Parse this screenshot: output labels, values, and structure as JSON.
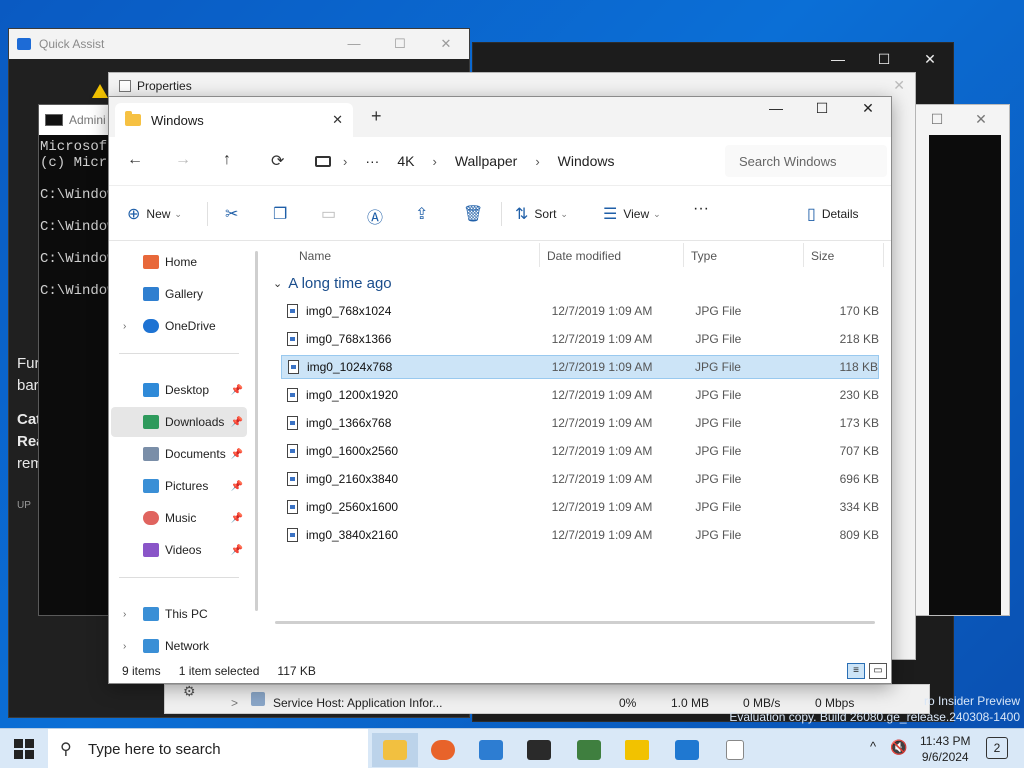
{
  "quick_assist": {
    "title": "Quick Assist",
    "body_lines": [
      "Fur",
      "bar",
      "Cat",
      "Rea",
      "rem",
      "UP"
    ],
    "min": "—",
    "max": "☐",
    "close": "✕"
  },
  "back_window": {
    "min": "—",
    "max": "☐",
    "close": "✕"
  },
  "cmd": {
    "title": "Admini",
    "lines": [
      "Microsoft",
      "(c) Micro",
      "",
      "C:\\Window",
      "",
      "C:\\Window",
      "",
      "C:\\Window",
      "",
      "C:\\Window"
    ]
  },
  "properties": {
    "title": "Properties",
    "close": "✕"
  },
  "task_manager": {
    "process": "Service Host: Application Infor...",
    "cpu": "0%",
    "memory": "1.0 MB",
    "disk": "0 MB/s",
    "network": "0 Mbps",
    "expand": ">"
  },
  "right_window": {
    "max": "☐",
    "close": "✕"
  },
  "explorer": {
    "tab_title": "Windows",
    "tab_close": "✕",
    "new_tab": "+",
    "window_controls": {
      "min": "—",
      "max": "☐",
      "close": "✕"
    },
    "nav": {
      "back": "←",
      "forward": "→",
      "up": "↑",
      "refresh": "⟳"
    },
    "breadcrumb": [
      "4K",
      "Wallpaper",
      "Windows"
    ],
    "breadcrumb_more": "···",
    "breadcrumb_sep": "›",
    "search_placeholder": "Search Windows",
    "toolbar": {
      "new": "New",
      "sort": "Sort",
      "view": "View",
      "more": "···",
      "details": "Details"
    },
    "sidebar": {
      "items": [
        {
          "label": "Home",
          "icon": "home-icon",
          "color": "#e8683a"
        },
        {
          "label": "Gallery",
          "icon": "gallery-icon",
          "color": "#2f7fd0"
        },
        {
          "label": "OneDrive",
          "icon": "onedrive-icon",
          "color": "#1e73d3"
        },
        {
          "label": "Desktop",
          "icon": "desktop-icon",
          "color": "#2f8ad8"
        },
        {
          "label": "Downloads",
          "icon": "downloads-icon",
          "color": "#2e9a5c"
        },
        {
          "label": "Documents",
          "icon": "documents-icon",
          "color": "#7a8ea8"
        },
        {
          "label": "Pictures",
          "icon": "pictures-icon",
          "color": "#3a8fd6"
        },
        {
          "label": "Music",
          "icon": "music-icon",
          "color": "#e0645f"
        },
        {
          "label": "Videos",
          "icon": "videos-icon",
          "color": "#8a55c8"
        },
        {
          "label": "This PC",
          "icon": "this-pc-icon",
          "color": "#3a8fd6"
        },
        {
          "label": "Network",
          "icon": "network-icon",
          "color": "#3a8fd6"
        }
      ]
    },
    "columns": {
      "name": "Name",
      "date": "Date modified",
      "type": "Type",
      "size": "Size"
    },
    "group_label": "A long time ago",
    "files": [
      {
        "name": "img0_768x1024",
        "date": "12/7/2019 1:09 AM",
        "type": "JPG File",
        "size": "170 KB"
      },
      {
        "name": "img0_768x1366",
        "date": "12/7/2019 1:09 AM",
        "type": "JPG File",
        "size": "218 KB"
      },
      {
        "name": "img0_1024x768",
        "date": "12/7/2019 1:09 AM",
        "type": "JPG File",
        "size": "118 KB"
      },
      {
        "name": "img0_1200x1920",
        "date": "12/7/2019 1:09 AM",
        "type": "JPG File",
        "size": "230 KB"
      },
      {
        "name": "img0_1366x768",
        "date": "12/7/2019 1:09 AM",
        "type": "JPG File",
        "size": "173 KB"
      },
      {
        "name": "img0_1600x2560",
        "date": "12/7/2019 1:09 AM",
        "type": "JPG File",
        "size": "707 KB"
      },
      {
        "name": "img0_2160x3840",
        "date": "12/7/2019 1:09 AM",
        "type": "JPG File",
        "size": "696 KB"
      },
      {
        "name": "img0_2560x1600",
        "date": "12/7/2019 1:09 AM",
        "type": "JPG File",
        "size": "334 KB"
      },
      {
        "name": "img0_3840x2160",
        "date": "12/7/2019 1:09 AM",
        "type": "JPG File",
        "size": "809 KB"
      }
    ],
    "selected_file": "img0_1024x768",
    "status": {
      "count": "9 items",
      "selection": "1 item selected",
      "size": "117 KB"
    }
  },
  "taskbar": {
    "search_placeholder": "Type here to search",
    "time": "11:43 PM",
    "date": "9/6/2024",
    "notification_count": "2",
    "tray_chevron": "^",
    "apps": [
      {
        "name": "file-explorer",
        "color": "#f2c040",
        "active": true
      },
      {
        "name": "firefox",
        "color": "#e8632a",
        "active": false
      },
      {
        "name": "photos",
        "color": "#2d7dd2",
        "active": false
      },
      {
        "name": "terminal",
        "color": "#2a2a2a",
        "active": false
      },
      {
        "name": "device-manager",
        "color": "#3f7f3f",
        "active": false
      },
      {
        "name": "warning",
        "color": "#f2c200",
        "active": false
      },
      {
        "name": "remote-desktop",
        "color": "#1f78d1",
        "active": false
      },
      {
        "name": "notepad",
        "color": "#ffffff",
        "active": false
      }
    ]
  },
  "watermark": {
    "line1": "ro Insider Preview",
    "line2": "Evaluation copy. Build 26080.ge_release.240308-1400"
  }
}
